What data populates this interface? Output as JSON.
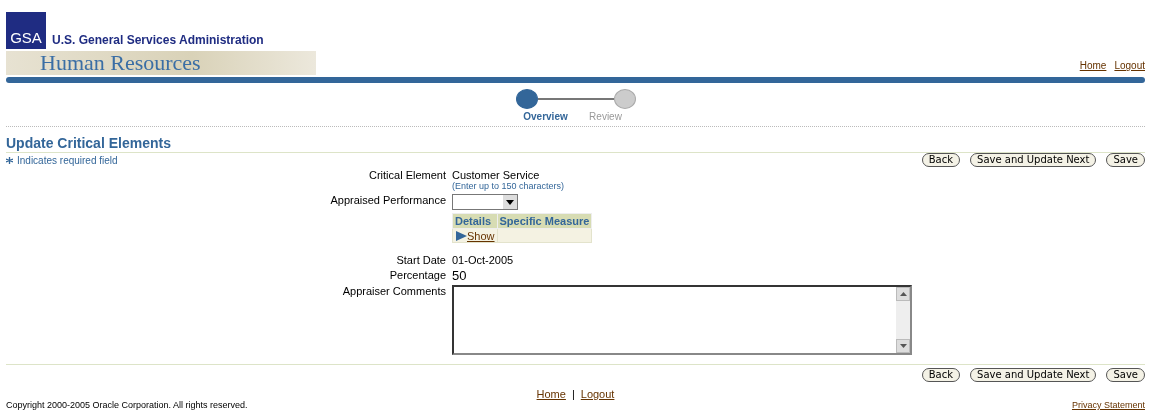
{
  "branding": {
    "logo_text": "GSA",
    "agency": "U.S. General Services Administration",
    "app_name": "Human Resources"
  },
  "global_links": [
    "Home",
    "Logout"
  ],
  "train": [
    {
      "label": "Overview",
      "selected": true
    },
    {
      "label": "Review",
      "selected": false
    }
  ],
  "page_title": "Update Critical Elements",
  "required_note": "Indicates required field",
  "buttons_top": [
    "Back",
    "Save and Update Next",
    "Save"
  ],
  "form": {
    "critical_element_label": "Critical Element",
    "critical_element_value": "Customer Service",
    "critical_element_hint": "(Enter up to 150 characters)",
    "appraised_performance_label": "Appraised Performance",
    "details_table": {
      "columns": [
        "Details",
        "Specific Measure"
      ],
      "show_link": "Show"
    },
    "start_date_label": "Start Date",
    "start_date_value": "01-Oct-2005",
    "percentage_label": "Percentage",
    "percentage_value": "50",
    "comments_label": "Appraiser Comments"
  },
  "buttons_bottom": [
    "Back",
    "Save and Update Next",
    "Save"
  ],
  "footer": {
    "links": [
      "Home",
      "Logout"
    ],
    "separator": "|",
    "copyright": "Copyright 2000-2005 Oracle Corporation. All rights reserved.",
    "privacy": "Privacy Statement"
  }
}
